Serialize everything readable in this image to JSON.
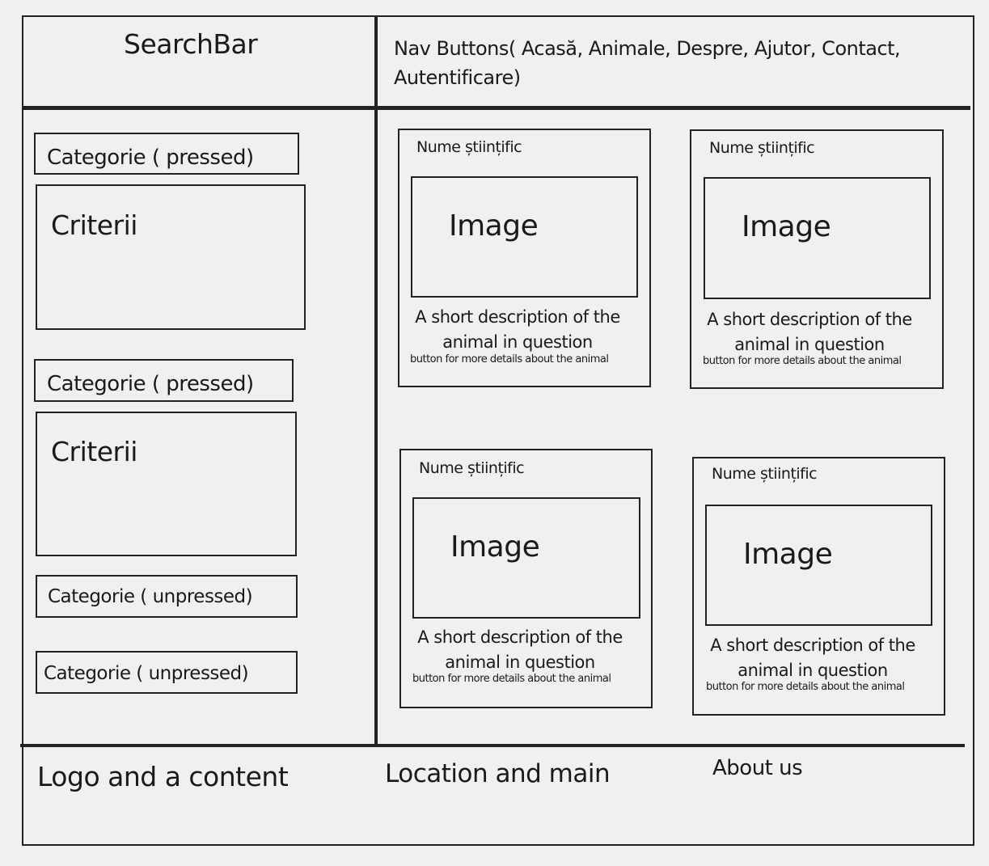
{
  "header": {
    "search_bar": "SearchBar",
    "nav_line1": "Nav Buttons( Acasă, Animale, Despre, Ajutor, Contact,",
    "nav_line2": "Autentificare)"
  },
  "sidebar": {
    "items": [
      {
        "category": "Categorie ( pressed)",
        "criteria": "Criterii"
      },
      {
        "category": "Categorie ( pressed)",
        "criteria": "Criterii"
      },
      {
        "category": "Categorie ( unpressed)"
      },
      {
        "category": "Categorie ( unpressed)"
      }
    ]
  },
  "cards": [
    {
      "name": "Nume științific",
      "image": "Image",
      "description": "A short description of the animal in question",
      "button": "button for more details about the animal"
    },
    {
      "name": "Nume științific",
      "image": "Image",
      "description": "A short description of the animal in question",
      "button": "button for more details about the animal"
    },
    {
      "name": "Nume științific",
      "image": "Image",
      "description": "A short description of the animal in question",
      "button": "button for more details about the animal"
    },
    {
      "name": "Nume științific",
      "image": "Image",
      "description": "A short description of the animal in question",
      "button": "button for more details about the animal"
    }
  ],
  "footer": {
    "col1": "Logo and a content",
    "col2": "Location and main",
    "col3": "About us"
  }
}
